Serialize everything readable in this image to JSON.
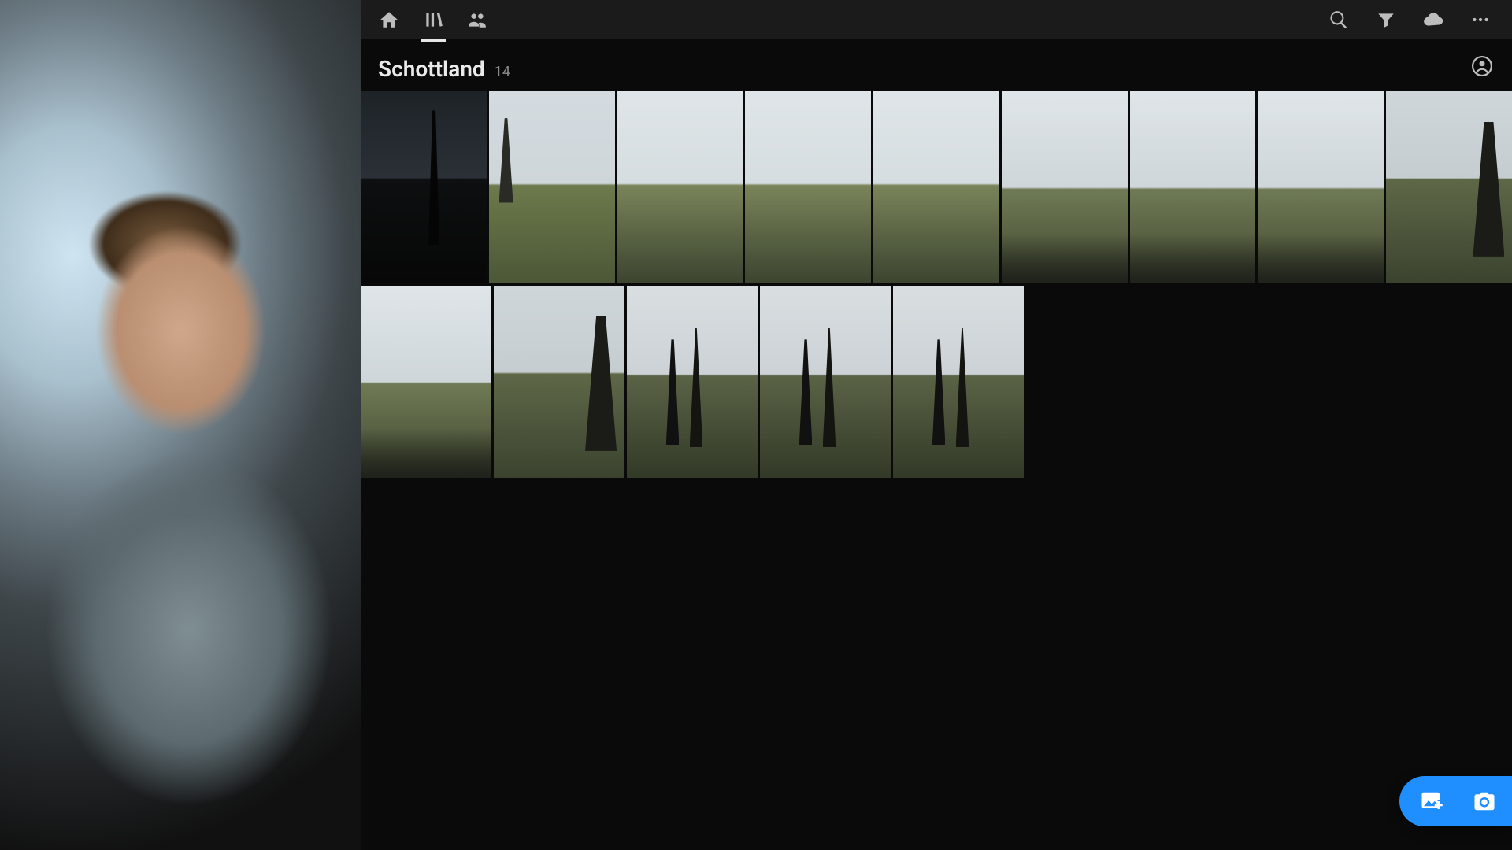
{
  "album": {
    "title": "Schottland",
    "count": "14"
  },
  "nav": {
    "home": "home-icon",
    "library": "library-icon",
    "shared": "people-icon",
    "search": "search-icon",
    "filter": "filter-icon",
    "cloud": "cloud-icon",
    "more": "more-icon",
    "profile": "profile-icon"
  },
  "fab": {
    "add_photos": "add-photos-icon",
    "camera": "camera-icon"
  },
  "photos_row1_count": 9,
  "photos_row2_count": 5
}
